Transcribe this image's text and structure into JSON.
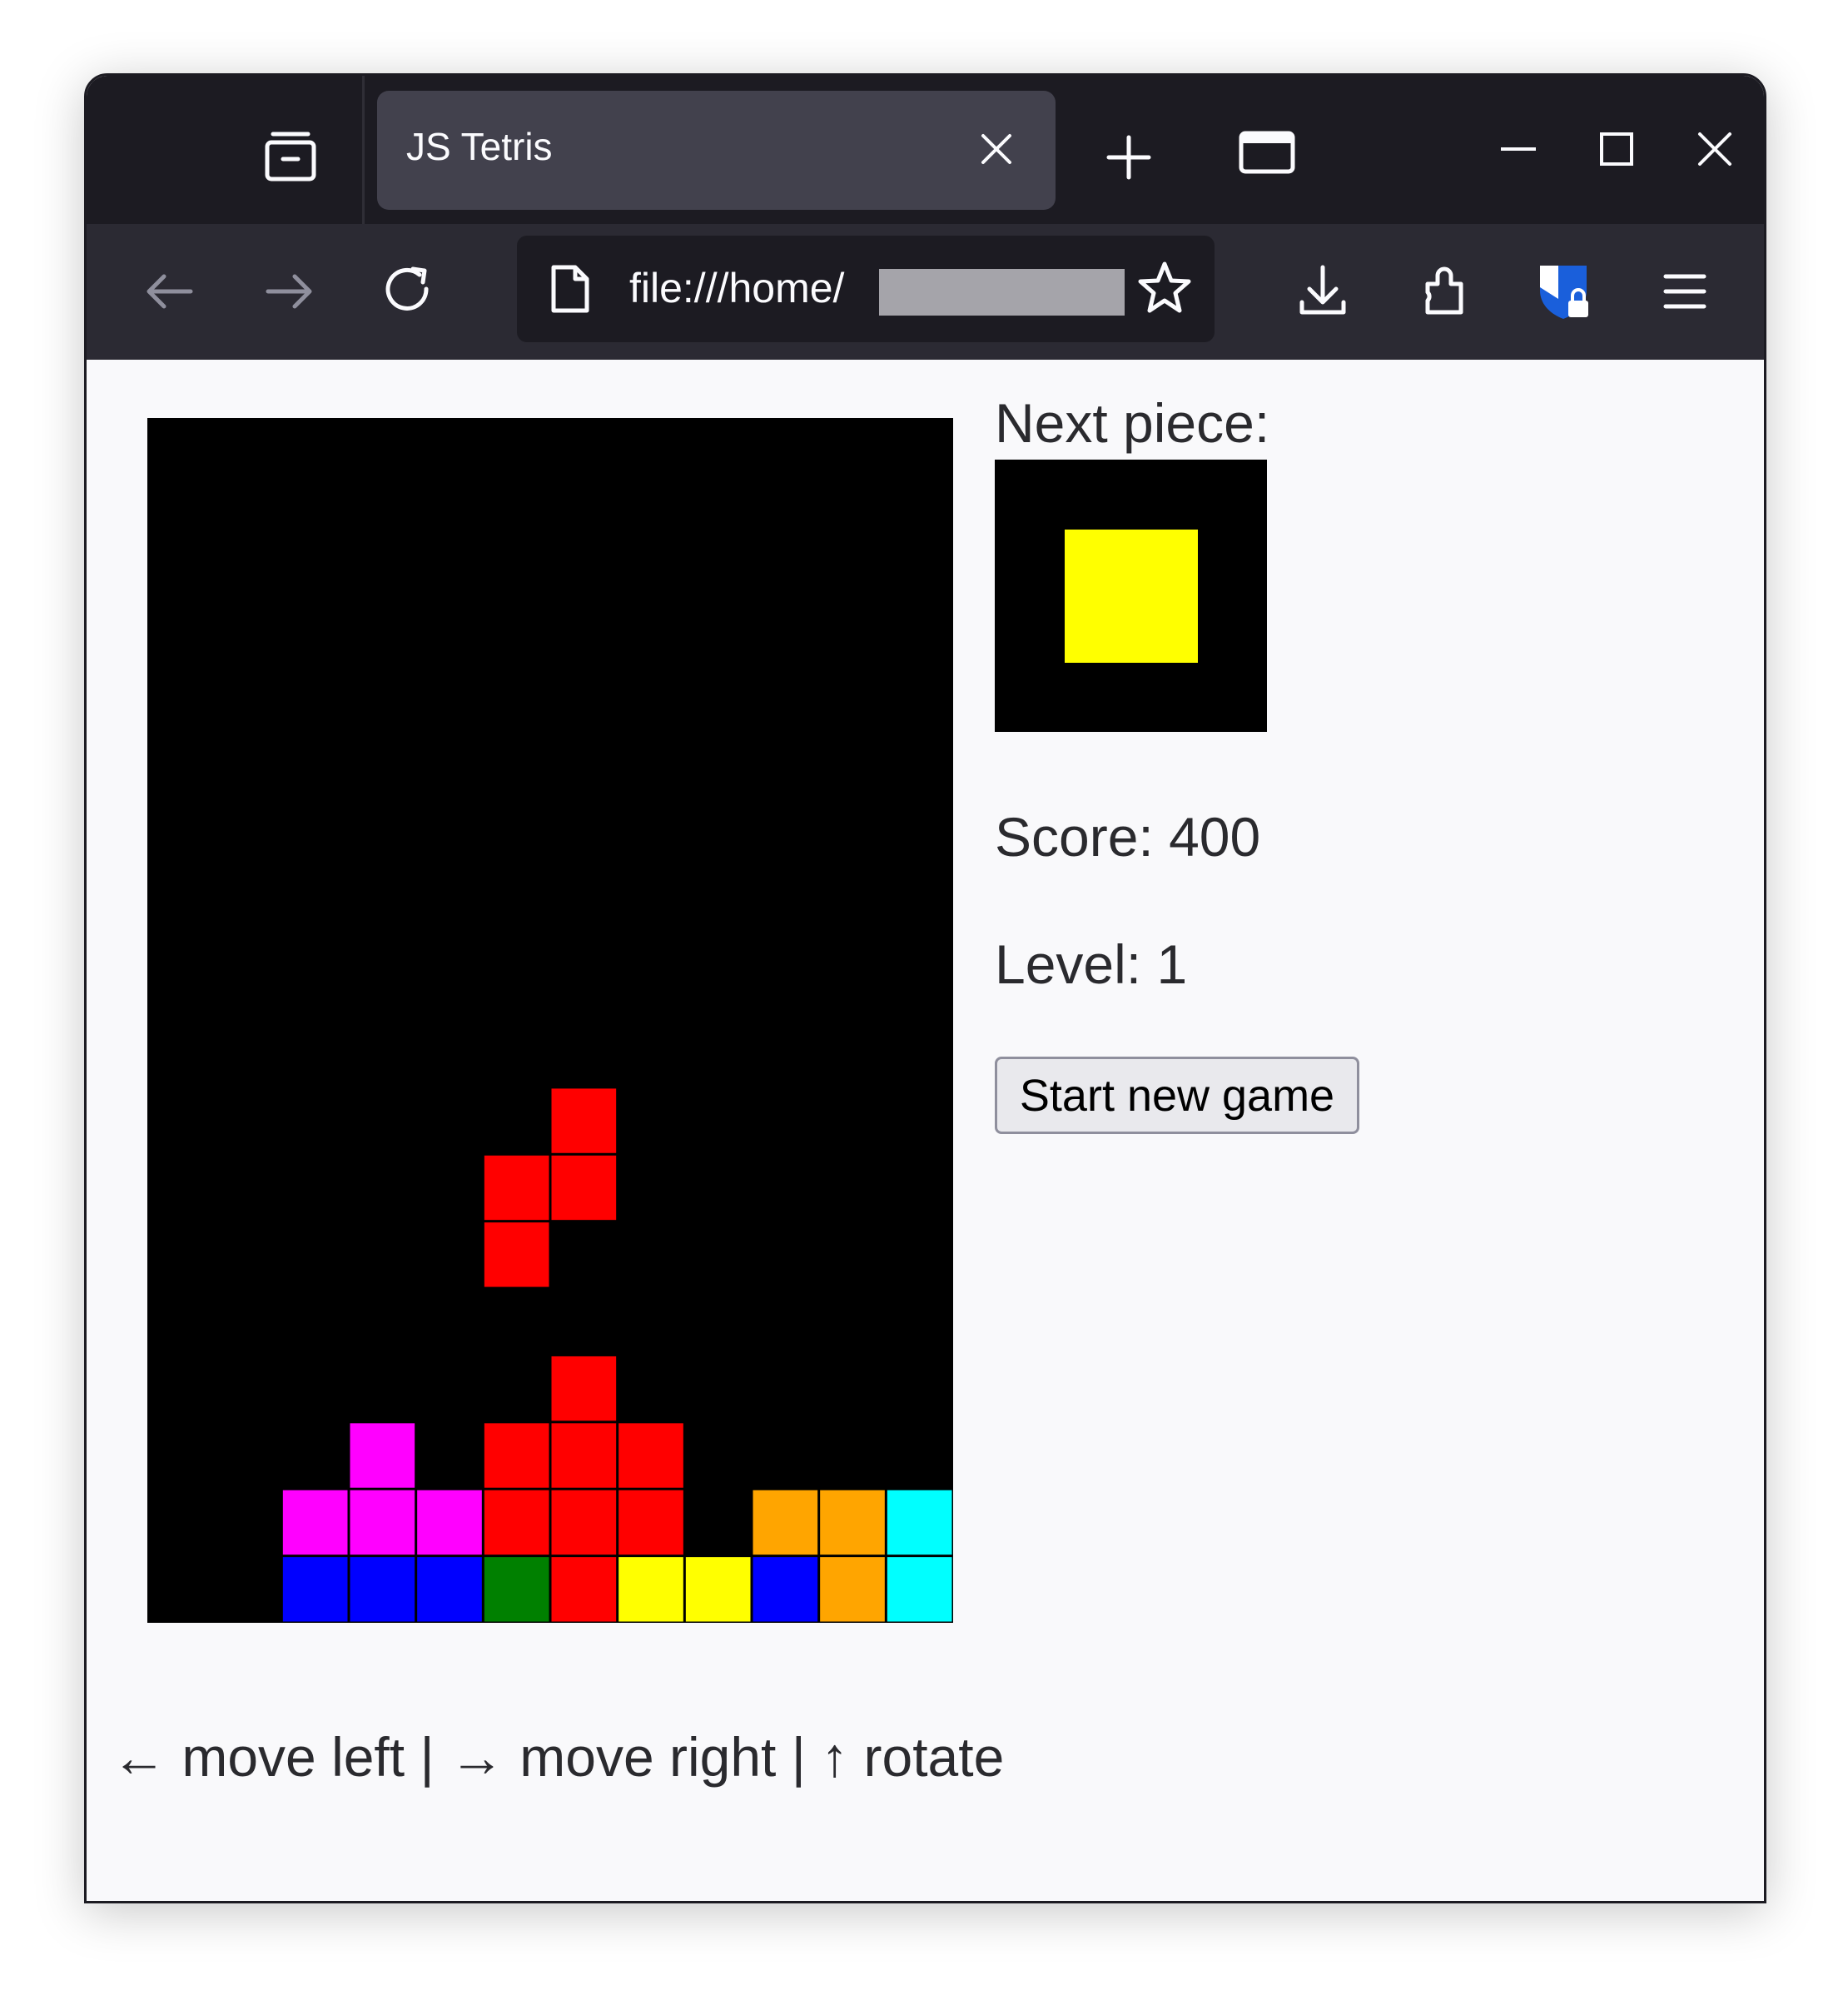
{
  "browser": {
    "tab_title": "JS Tetris",
    "url": "file:///home/",
    "colors": {
      "titlebar": "#1c1b22",
      "toolbar": "#2b2a33",
      "urlbar": "#1c1b22",
      "icon": "#fbfbfe"
    }
  },
  "game": {
    "next_label": "Next piece:",
    "score_text": "Score: 400",
    "level_text": "Level: 1",
    "start_button_label": "Start new game",
    "controls_text": "← move left | → move right | ↑ rotate",
    "board_cols": 12,
    "board_rows": 18,
    "board": [
      {
        "row": 10,
        "col": 6,
        "color": "#ff0000"
      },
      {
        "row": 11,
        "col": 5,
        "color": "#ff0000"
      },
      {
        "row": 11,
        "col": 6,
        "color": "#ff0000"
      },
      {
        "row": 12,
        "col": 5,
        "color": "#ff0000"
      },
      {
        "row": 14,
        "col": 6,
        "color": "#ff0000"
      },
      {
        "row": 15,
        "col": 3,
        "color": "#ff00ff"
      },
      {
        "row": 15,
        "col": 5,
        "color": "#ff0000"
      },
      {
        "row": 15,
        "col": 6,
        "color": "#ff0000"
      },
      {
        "row": 15,
        "col": 7,
        "color": "#ff0000"
      },
      {
        "row": 16,
        "col": 2,
        "color": "#ff00ff"
      },
      {
        "row": 16,
        "col": 3,
        "color": "#ff00ff"
      },
      {
        "row": 16,
        "col": 4,
        "color": "#ff00ff"
      },
      {
        "row": 16,
        "col": 5,
        "color": "#ff0000"
      },
      {
        "row": 16,
        "col": 6,
        "color": "#ff0000"
      },
      {
        "row": 16,
        "col": 7,
        "color": "#ff0000"
      },
      {
        "row": 16,
        "col": 9,
        "color": "#ffa500"
      },
      {
        "row": 16,
        "col": 10,
        "color": "#ffa500"
      },
      {
        "row": 16,
        "col": 11,
        "color": "#00ffff"
      },
      {
        "row": 17,
        "col": 2,
        "color": "#0000ff"
      },
      {
        "row": 17,
        "col": 3,
        "color": "#0000ff"
      },
      {
        "row": 17,
        "col": 4,
        "color": "#0000ff"
      },
      {
        "row": 17,
        "col": 5,
        "color": "#008000"
      },
      {
        "row": 17,
        "col": 6,
        "color": "#ff0000"
      },
      {
        "row": 17,
        "col": 7,
        "color": "#ffff00"
      },
      {
        "row": 17,
        "col": 8,
        "color": "#ffff00"
      },
      {
        "row": 17,
        "col": 9,
        "color": "#0000ff"
      },
      {
        "row": 17,
        "col": 10,
        "color": "#ffa500"
      },
      {
        "row": 17,
        "col": 11,
        "color": "#00ffff"
      }
    ],
    "next_piece": {
      "shape": "O",
      "color": "#ffff00"
    }
  }
}
